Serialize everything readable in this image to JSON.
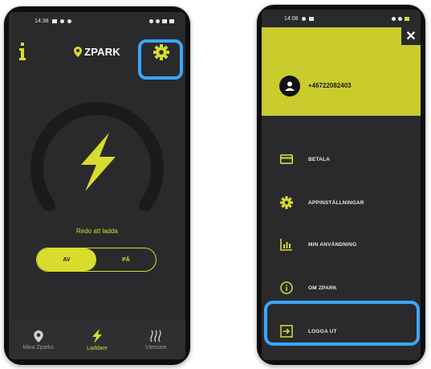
{
  "colors": {
    "accent": "#d8dc2e",
    "highlight": "#3aa6ff",
    "screen_bg": "#2a2a2c"
  },
  "left_phone": {
    "status_time": "14:38",
    "location_label": "ZPARK",
    "info_icon": "info-icon",
    "settings_icon": "gear-icon",
    "charge_icon": "lightning-icon",
    "status_text": "Redo att ladda",
    "toggle": {
      "off_label": "AV",
      "on_label": "PÅ",
      "selected": "AV"
    },
    "nav": [
      {
        "label": "Mina Zparks",
        "icon": "location-pin-icon",
        "active": false
      },
      {
        "label": "Laddare",
        "icon": "lightning-icon",
        "active": true
      },
      {
        "label": "Värmare",
        "icon": "heat-waves-icon",
        "active": false
      }
    ]
  },
  "right_phone": {
    "status_time": "14:08",
    "close_label": "✕",
    "phone_number": "+46722082403",
    "menu": [
      {
        "label": "BETALA",
        "icon": "card-icon"
      },
      {
        "label": "APPINSTÄLLNINGAR",
        "icon": "gear-icon"
      },
      {
        "label": "MIN ANVÄNDNING",
        "icon": "bar-chart-icon"
      },
      {
        "label": "OM ZPARK",
        "icon": "info-circle-icon"
      },
      {
        "label": "LOGGA UT",
        "icon": "logout-icon"
      }
    ]
  }
}
